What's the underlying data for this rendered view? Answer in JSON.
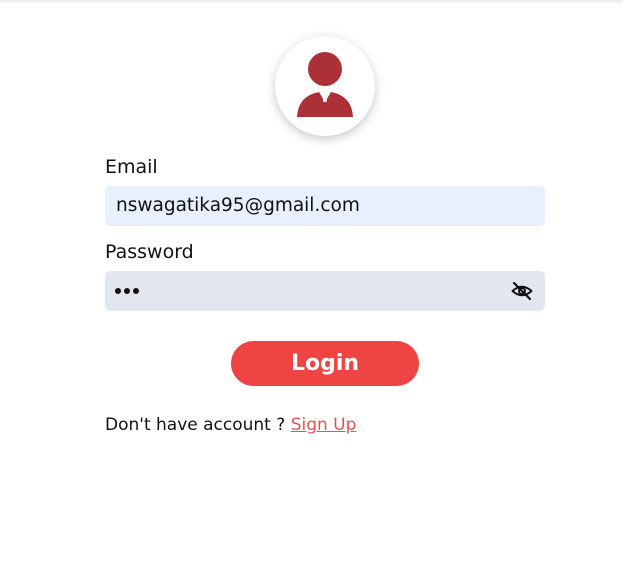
{
  "colors": {
    "accent": "#ef4444",
    "avatar": "#ac3136",
    "link": "#e05555",
    "email_field_bg": "#e8f0fe",
    "password_field_bg": "#e2e6ee"
  },
  "avatar": {
    "icon": "user-icon"
  },
  "form": {
    "email_label": "Email",
    "email_value": "nswagatika95@gmail.com",
    "password_label": "Password",
    "password_length": 3,
    "toggle_icon": "eye-slash-icon",
    "login_label": "Login"
  },
  "footer": {
    "prompt": "Don't have account ?",
    "signup_link": "Sign Up"
  }
}
